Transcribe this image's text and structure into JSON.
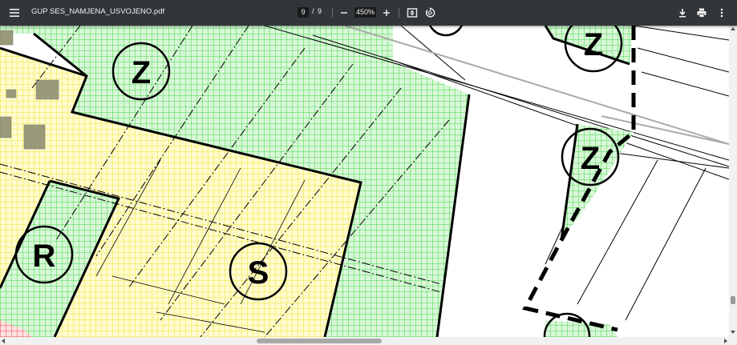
{
  "toolbar": {
    "filename": "GUP SES_NAMJENA_USVOJENO.pdf",
    "current_page": "9",
    "page_separator": "/",
    "total_pages": "9",
    "zoom": "450%",
    "icons": {
      "menu": "menu-icon",
      "zoom_out": "minus-icon",
      "zoom_in": "plus-icon",
      "fit": "fit-page-icon",
      "rotate": "rotate-icon",
      "download": "download-icon",
      "print": "print-icon",
      "more": "more-vert-icon"
    }
  },
  "map": {
    "labels": {
      "z1": "Z",
      "z2": "Z",
      "z3": "Z",
      "r": "R",
      "s": "S"
    },
    "colors": {
      "green_grid": "#22cc22",
      "yellow_grid": "#e8e000",
      "green_bg": "#d8f7d8",
      "yellow_bg": "#fffbd0",
      "outline": "#000000"
    }
  }
}
